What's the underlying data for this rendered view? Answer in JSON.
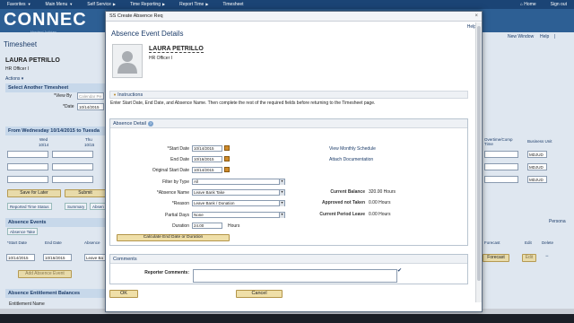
{
  "topnav": {
    "items": [
      "Favorites",
      "Main Menu",
      "Self Service",
      "Time Reporting",
      "Report Time",
      "Timesheet"
    ],
    "home": "Home",
    "signout": "Sign out"
  },
  "banner": {
    "logo": "CONNEC",
    "logo_sub": "Maryland Judiciary"
  },
  "background": {
    "title": "Timesheet",
    "name": "LAURA PETRILLO",
    "job": "HR Officer I",
    "actions": "Actions",
    "select_another": "Select Another Timesheet",
    "view_by_label": "*View By",
    "view_by_value": "Calendar Pe",
    "date_label": "*Date",
    "date_value": "10/14/2015",
    "from_header": "From Wednesday 10/14/2015 to Tuesda",
    "day1": "Wed",
    "day1_date": "10/14",
    "day2": "Thu",
    "day2_date": "10/15",
    "save_later": "Save for Later",
    "submit": "Submit",
    "tab1": "Reported Time Status",
    "tab2": "Summary",
    "tab3": "Absen",
    "absence_events": "Absence Events",
    "absence_take": "Absence Take",
    "col_start": "*Start Date",
    "col_end": "End Date",
    "col_abs": "Absence",
    "row_start": "10/14/2015",
    "row_end": "10/16/2015",
    "row_abs": "Leave Ba",
    "add_event": "Add Absence Event",
    "entitlement": "Absence Entitlement Balances",
    "entitlement_name": "Entitlement Name",
    "new_window": "New Window",
    "help": "Help",
    "overtime": "Overtime/Comp Time",
    "business_unit": "Business Unit",
    "bu_value": "MDJUD",
    "personal": "Persona",
    "forecast": "Forecast",
    "edit": "Edit",
    "delete": "Delete",
    "forecast_btn": "Forecast",
    "edit_btn": "Edit"
  },
  "modal": {
    "header": "SS Create Absence Req",
    "close": "×",
    "help": "Help",
    "title": "Absence Event Details",
    "employee_name": "LAURA PETRILLO",
    "employee_job": "HR Officer I",
    "instructions_header": "Instructions",
    "instructions_text": "Enter Start Date, End Date, and Absence Name. Then complete the rest of the required fields before returning to the Timesheet page.",
    "detail_header": "Absence Detail",
    "start_date_label": "*Start Date",
    "start_date": "10/14/2015",
    "end_date_label": "End Date",
    "end_date": "10/16/2015",
    "orig_start_label": "Original Start Date",
    "orig_start": "10/14/2015",
    "filter_label": "Filter by Type",
    "filter_value": "All",
    "absence_name_label": "*Absence Name",
    "absence_name_value": "Leave Bank Take",
    "reason_label": "*Reason",
    "reason_value": "Leave Bank / Donation",
    "partial_label": "Partial Days",
    "partial_value": "None",
    "duration_label": "Duration",
    "duration_value": "24.00",
    "duration_unit": "Hours",
    "calc_button": "Calculate End Date or Duration",
    "view_monthly": "View Monthly Schedule",
    "attach_doc": "Attach Documentation",
    "current_balance_label": "Current Balance",
    "current_balance_value": "320.00 Hours",
    "approved_label": "Approved not Taken",
    "approved_value": "0.00 Hours",
    "current_period_label": "Current Period Leave",
    "current_period_value": "0.00 Hours",
    "comments_header": "Comments",
    "reporter_comments_label": "Reporter Comments:",
    "ok": "OK",
    "cancel": "Cancel"
  }
}
